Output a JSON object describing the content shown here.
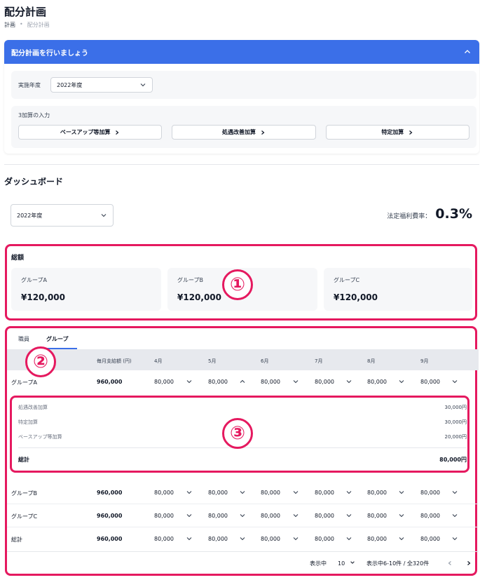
{
  "page": {
    "title": "配分計画"
  },
  "breadcrumb": {
    "items": [
      "計画",
      "配分計画"
    ],
    "separator": "•"
  },
  "plan": {
    "header": "配分計画を行いましょう",
    "year_label": "実施年度",
    "year_value": "2022年度",
    "input_label": "3加算の入力",
    "buttons": [
      "ベースアップ等加算",
      "処遇改善加算",
      "特定加算"
    ]
  },
  "dashboard": {
    "title": "ダッシュボード",
    "year_value": "2022年度",
    "welfare_label": "法定福利費率：",
    "welfare_value": "0.3%"
  },
  "totals": {
    "title": "総額",
    "cards": [
      {
        "name": "グループA",
        "amount": "¥120,000"
      },
      {
        "name": "グループB",
        "amount": "¥120,000"
      },
      {
        "name": "グループC",
        "amount": "¥120,000"
      }
    ]
  },
  "tabs": [
    {
      "label": "職員"
    },
    {
      "label": "グループ"
    }
  ],
  "table": {
    "headers": [
      "毎月支給額 (円)",
      "4月",
      "5月",
      "6月",
      "7月",
      "8月",
      "9月"
    ],
    "rows": [
      {
        "name": "グループA",
        "total": "960,000",
        "months": [
          "80,000",
          "80,000",
          "80,000",
          "80,000",
          "80,000",
          "80,000"
        ]
      },
      {
        "name": "グループB",
        "total": "960,000",
        "months": [
          "80,000",
          "80,000",
          "80,000",
          "80,000",
          "80,000",
          "80,000"
        ]
      },
      {
        "name": "グループC",
        "total": "960,000",
        "months": [
          "80,000",
          "80,000",
          "80,000",
          "80,000",
          "80,000",
          "80,000"
        ]
      },
      {
        "name": "総計",
        "total": "960,000",
        "months": [
          "80,000",
          "80,000",
          "80,000",
          "80,000",
          "80,000",
          "80,000"
        ]
      }
    ],
    "detail": {
      "lines": [
        {
          "label": "処遇改善加算",
          "value": "30,000円"
        },
        {
          "label": "特定加算",
          "value": "30,000円"
        },
        {
          "label": "ベースアップ等加算",
          "value": "20,000円"
        }
      ],
      "total_label": "総計",
      "total_value": "80,000円"
    }
  },
  "pager": {
    "showing_label": "表示中",
    "page_size": "10",
    "range_text": "表示中6-10件 / 全320件"
  },
  "annotations": [
    "①",
    "②",
    "③"
  ],
  "colors": {
    "primary": "#3b6fe8",
    "annotation": "#e5195f"
  }
}
